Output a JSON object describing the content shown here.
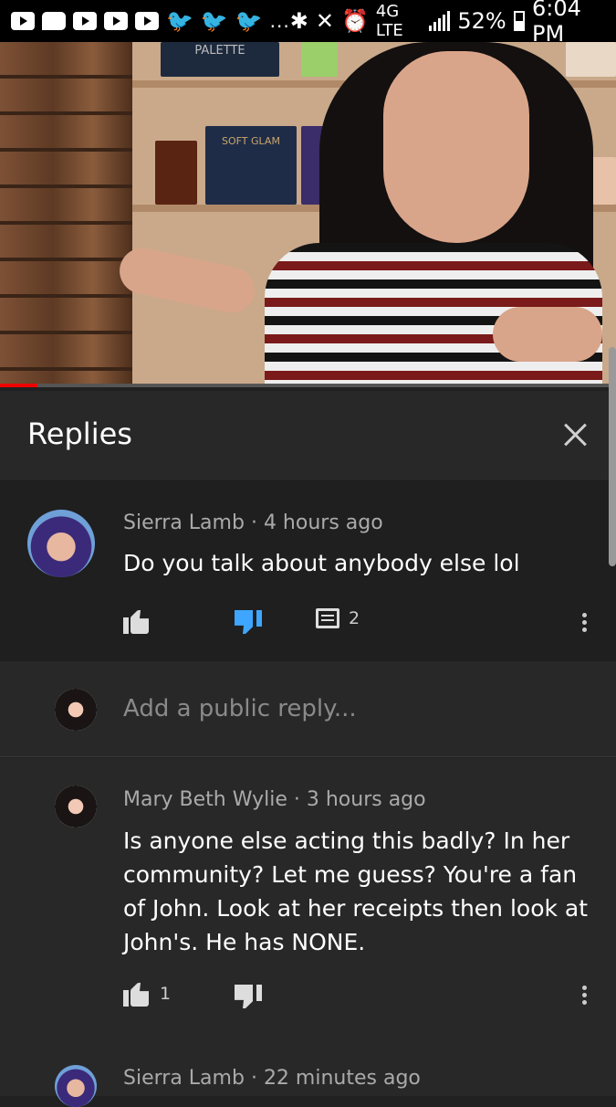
{
  "status_bar": {
    "network": "4G LTE",
    "battery": "52%",
    "time": "6:04 PM",
    "overflow": "..."
  },
  "video": {
    "shelf_box_label": "PALETTE",
    "product_label": "SOFT GLAM",
    "progress_fraction": 0.06
  },
  "replies_panel": {
    "title": "Replies"
  },
  "top_comment": {
    "author": "Sierra Lamb",
    "age": "4 hours ago",
    "text": "Do you talk about anybody else lol",
    "reply_count": "2"
  },
  "reply_input": {
    "placeholder": "Add a public reply..."
  },
  "replies": [
    {
      "author": "Mary Beth Wylie",
      "age": "3 hours ago",
      "text": "Is anyone else acting this badly? In her community? Let me guess? You're a fan of John. Look at her receipts then look at John's. He has NONE.",
      "like_count": "1"
    },
    {
      "author": "Sierra Lamb",
      "age": "22 minutes ago"
    }
  ],
  "colors": {
    "dislike_active": "#3ea6ff",
    "background": "#212121"
  }
}
